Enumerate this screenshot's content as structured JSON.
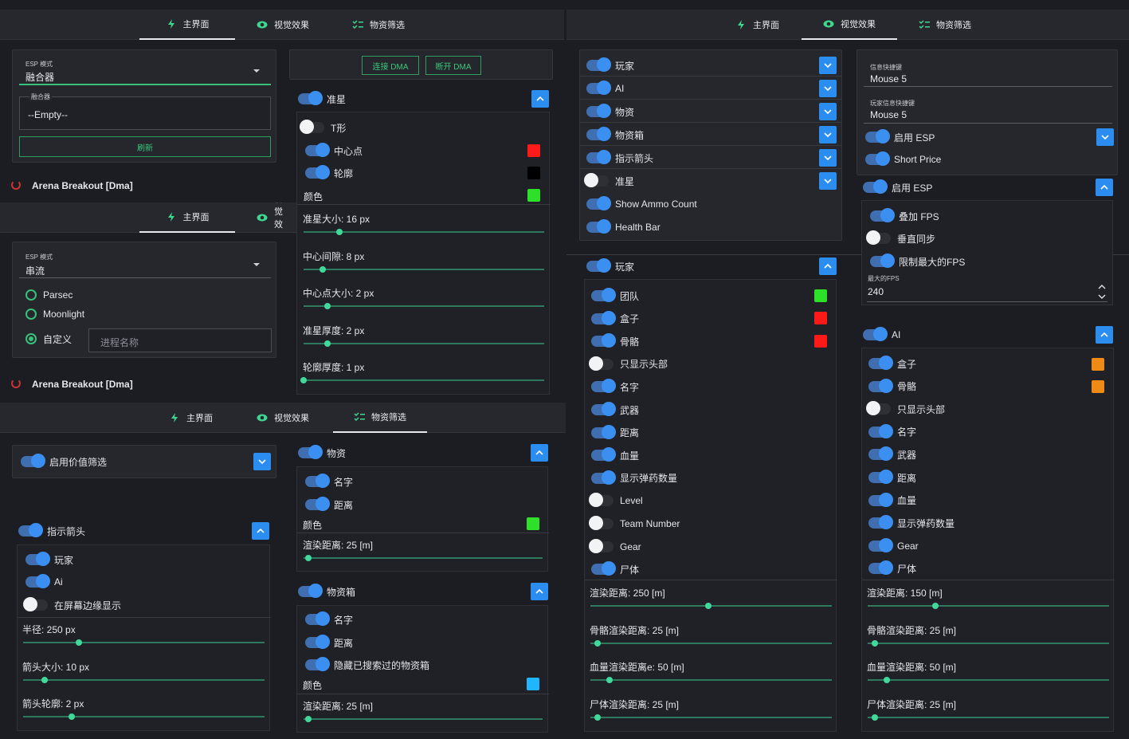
{
  "tabs": {
    "main": "主界面",
    "visual": "视觉效果",
    "loot": "物资筛选"
  },
  "app_title": "Arena Breakout [Dma]",
  "p1": {
    "esp_mode_label": "ESP 模式",
    "esp_mode_value": "融合器",
    "fuser_label": "融合器",
    "fuser_value": "--Empty--",
    "refresh": "刷新",
    "connect": "连接 DMA",
    "disconnect": "断开 DMA",
    "crosshair": "准星",
    "t_shape": "T形",
    "center_dot": "中心点",
    "outline": "轮廓",
    "color": "颜色",
    "sliders": [
      {
        "label": "准星大小: 16 px",
        "pos": 0.15
      },
      {
        "label": "中心间隙: 8 px",
        "pos": 0.08
      },
      {
        "label": "中心点大小: 2 px",
        "pos": 0.1
      },
      {
        "label": "准星厚度: 2 px",
        "pos": 0.1
      },
      {
        "label": "轮廓厚度: 1 px",
        "pos": 0.0
      }
    ]
  },
  "p2": {
    "esp_mode_label": "ESP 模式",
    "esp_mode_value": "串流",
    "radios": [
      "Parsec",
      "Moonlight",
      "自定义"
    ],
    "process_placeholder": "进程名称"
  },
  "p3": {
    "value_filter": "启用价值筛选",
    "arrows": "指示箭头",
    "player": "玩家",
    "ai": "Ai",
    "edge_show": "在屏幕边缘显示",
    "arrow_sliders": [
      {
        "label": "半径: 250 px",
        "pos": 0.23
      },
      {
        "label": "箭头大小: 10 px",
        "pos": 0.09
      },
      {
        "label": "箭头轮廓: 2 px",
        "pos": 0.2
      }
    ],
    "loot": "物资",
    "name": "名字",
    "distance": "距离",
    "color": "颜色",
    "loot_render": "渲染距离: 25 [m]",
    "loot_render_pos": 0.02,
    "crate": "物资箱",
    "hide_searched": "隐藏已搜索过的物资箱",
    "crate_render": "渲染距离: 25 [m]",
    "crate_render_pos": 0.02
  },
  "visual": {
    "list": [
      "玩家",
      "AI",
      "物资",
      "物资箱",
      "指示箭头",
      "准星",
      "Show Ammo Count",
      "Health Bar"
    ],
    "player_header": "玩家",
    "player_items": [
      "团队",
      "盒子",
      "骨骼",
      "只显示头部",
      "名字",
      "武器",
      "距离",
      "血量",
      "显示弹药数量",
      "Level",
      "Team Number",
      "Gear",
      "尸体"
    ],
    "player_sliders": [
      {
        "label": "渲染距离: 250 [m]",
        "pos": 0.49
      },
      {
        "label": "骨骼渲染距离: 25 [m]",
        "pos": 0.03
      },
      {
        "label": "血量渲染距离e: 50 [m]",
        "pos": 0.08
      },
      {
        "label": "尸体渲染距离: 25 [m]",
        "pos": 0.03
      }
    ]
  },
  "right": {
    "hotkey1_label": "信息快捷键",
    "hotkey1_value": "Mouse 5",
    "hotkey2_label": "玩家信息快捷键",
    "hotkey2_value": "Mouse 5",
    "enable_esp": "启用 ESP",
    "short_price": "Short Price",
    "esp_header": "启用 ESP",
    "overlay_fps": "叠加 FPS",
    "vsync": "垂直同步",
    "limit_fps": "限制最大的FPS",
    "max_fps_label": "最大的FPS",
    "max_fps_value": "240",
    "ai_header": "AI",
    "ai_items": [
      "盒子",
      "骨骼",
      "只显示头部",
      "名字",
      "武器",
      "距离",
      "血量",
      "显示弹药数量",
      "Gear",
      "尸体"
    ],
    "ai_sliders": [
      {
        "label": "渲染距离: 150 [m]",
        "pos": 0.28
      },
      {
        "label": "骨骼渲染距离: 25 [m]",
        "pos": 0.03
      },
      {
        "label": "血量渲染距离: 50 [m]",
        "pos": 0.08
      },
      {
        "label": "尸体渲染距离: 25 [m]",
        "pos": 0.03
      }
    ]
  },
  "colors": {
    "red": "#ff1a1a",
    "green": "#2ee02a",
    "black": "#000000",
    "cyan": "#1fb6ff",
    "orange": "#f08a16"
  }
}
